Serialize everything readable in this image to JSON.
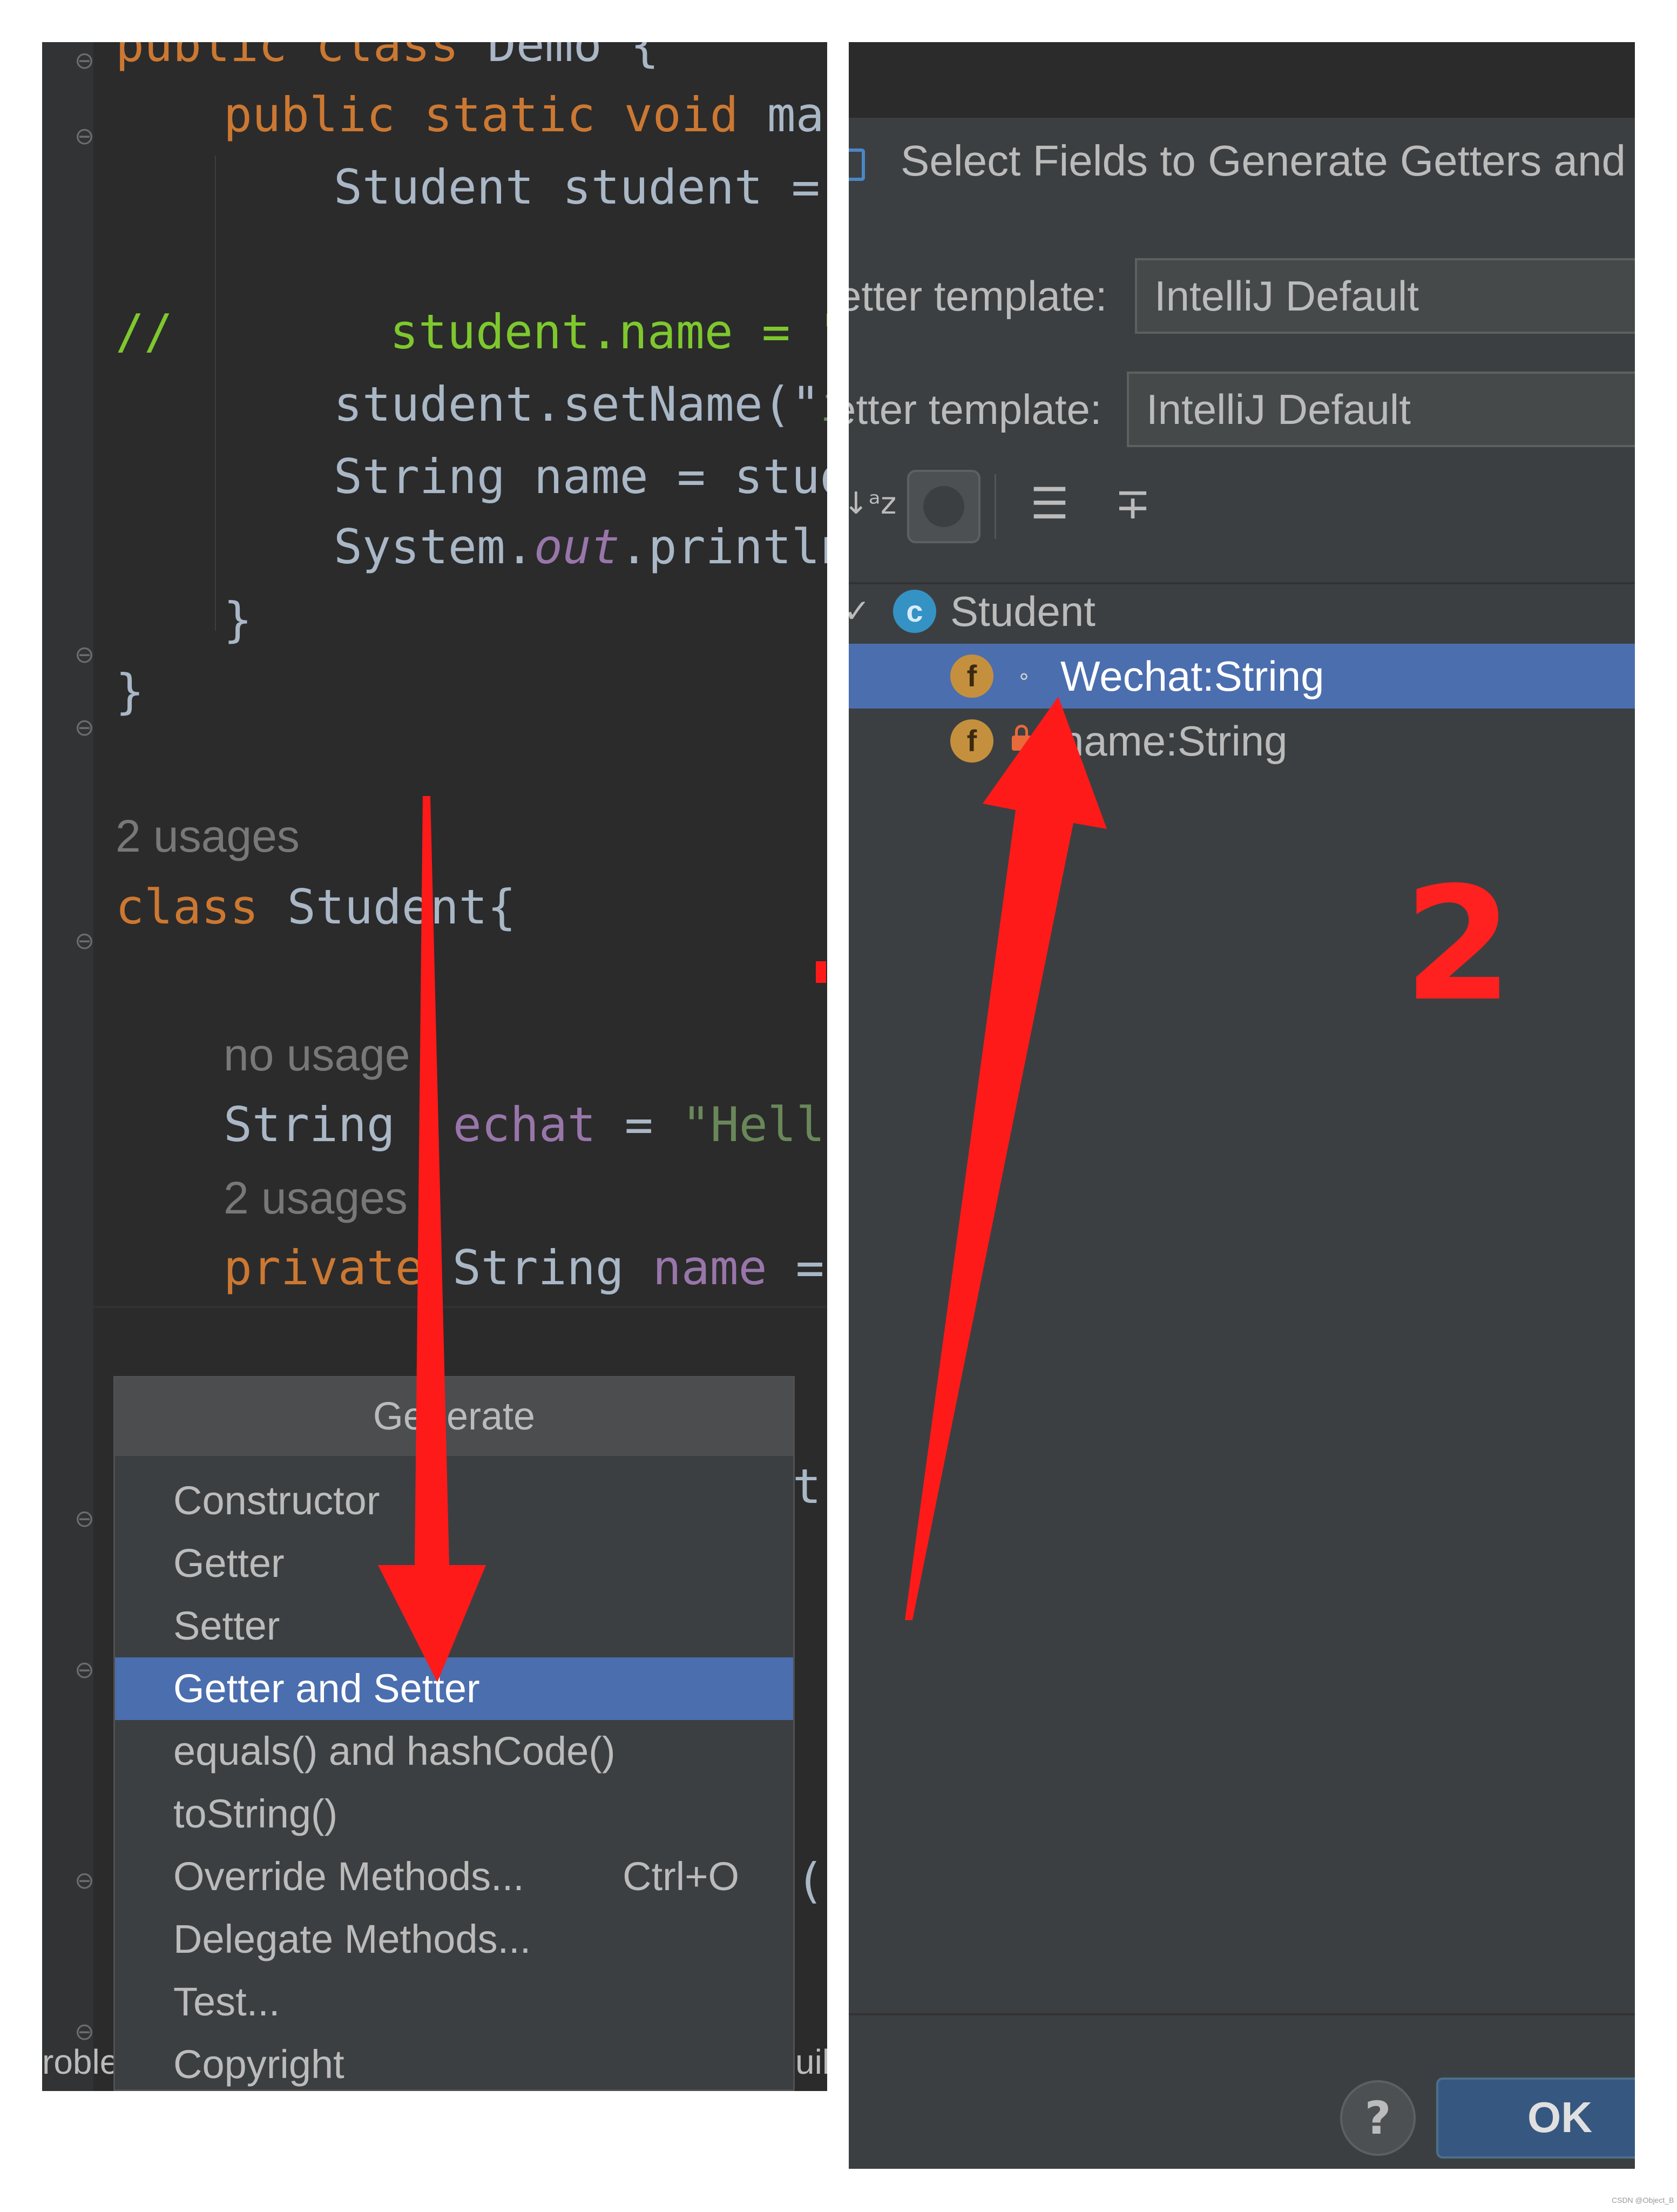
{
  "editor": {
    "lines": {
      "l1": {
        "kw": "public class ",
        "rest": "Demo {"
      },
      "l2": {
        "kw": "public static void ",
        "rest": "mai"
      },
      "l3": {
        "rest": "Student student = "
      },
      "l4_comment": "//",
      "l4": "student.name = \"",
      "l5a": "student.setName(\"",
      "l5b": "i",
      "l6": "String name = stud",
      "l7a": "System.",
      "l7b": "out",
      "l7c": ".println",
      "l8": "}",
      "l9": "}",
      "l10_hint": "2 usages",
      "l11_kw": "class ",
      "l11": "Student{",
      "l12_hint": "no usage",
      "l13a": "String ",
      "l13b": "echat",
      "l13c": " = ",
      "l13d": "\"Hello",
      "l14_hint": "2 usages",
      "l15_kw": "private ",
      "l15a": "String ",
      "l15b": "name",
      "l15c": " = "
    },
    "peek": {
      "p1": "t",
      "p2": "(",
      "bottom_left": "roble",
      "bottom_right": "uil"
    }
  },
  "generate_popup": {
    "title": "Generate",
    "items": [
      {
        "label": "Constructor",
        "shortcut": ""
      },
      {
        "label": "Getter",
        "shortcut": ""
      },
      {
        "label": "Setter",
        "shortcut": ""
      },
      {
        "label": "Getter and Setter",
        "shortcut": ""
      },
      {
        "label": "equals() and hashCode()",
        "shortcut": ""
      },
      {
        "label": "toString()",
        "shortcut": ""
      },
      {
        "label": "Override Methods...",
        "shortcut": "Ctrl+O"
      },
      {
        "label": "Delegate Methods...",
        "shortcut": ""
      },
      {
        "label": "Test...",
        "shortcut": ""
      },
      {
        "label": "Copyright",
        "shortcut": ""
      }
    ],
    "selected_index": 3
  },
  "dialog": {
    "title": "Select Fields to Generate Getters and S",
    "getter_label": "etter template:",
    "getter_value": "IntelliJ Default",
    "setter_label": "etter template:",
    "setter_value": "IntelliJ Default",
    "tree": {
      "class_name": "Student",
      "fields": [
        {
          "label": "Wechat:String",
          "access_icon": "package-private-dot-icon",
          "selected": true
        },
        {
          "label": "name:String",
          "access_icon": "private-lock-icon",
          "selected": false
        }
      ]
    },
    "help_label": "?",
    "ok_label": "OK"
  },
  "annotations": {
    "step_number": "2",
    "arrow_color": "#ff1a1a"
  },
  "watermark": "CSDN @Object_B",
  "colors": {
    "keyword": "#cc7832",
    "string": "#6a8759",
    "selection": "#4b6eaf",
    "editor_bg": "#2b2b2b",
    "dialog_bg": "#3c3f41"
  }
}
